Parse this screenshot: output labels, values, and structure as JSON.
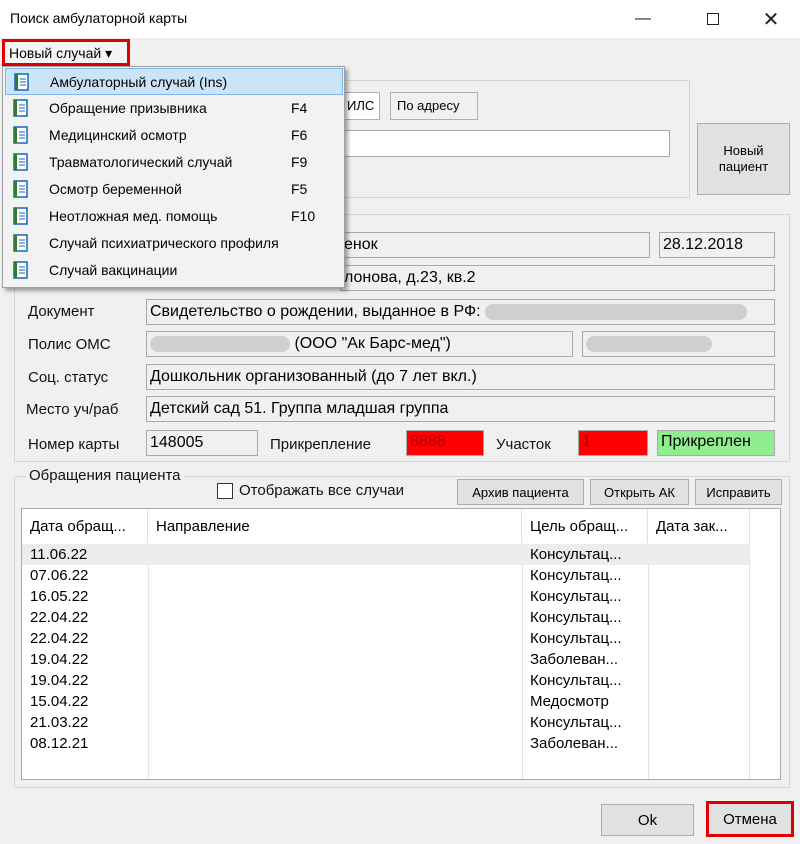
{
  "window": {
    "title": "Поиск амбулаторной карты"
  },
  "menu": {
    "new_case": "Новый случай ▾"
  },
  "dropdown": {
    "items": [
      {
        "label": "Амбулаторный случай (Ins)",
        "key": "",
        "selected": true
      },
      {
        "label": "Обращение призывника",
        "key": "F4"
      },
      {
        "label": "Медицинский осмотр",
        "key": "F6"
      },
      {
        "label": "Травматологический случай",
        "key": "F9"
      },
      {
        "label": "Осмотр беременной",
        "key": "F5"
      },
      {
        "label": "Неотложная мед. помощь",
        "key": "F10"
      },
      {
        "label": "Случай психиатрического профиля",
        "key": ""
      },
      {
        "label": "Случай вакцинации",
        "key": ""
      }
    ],
    "icon": "document-icon"
  },
  "search": {
    "tabs": [
      "ИЛС",
      "По адресу"
    ],
    "new_patient_button": "Новый пациент"
  },
  "patient": {
    "name_partial": "енок",
    "birth_date": "28.12.2018",
    "address_partial": "лонова, д.23, кв.2",
    "document_label": "Документ",
    "document_value": "Свидетельство о рождении, выданное в РФ:",
    "oms_label": "Полис ОМС",
    "oms_value": "(ООО \"Ак Барс-мед\")",
    "social_label": "Соц. статус",
    "social_value": "Дошкольник организованный (до 7 лет вкл.)",
    "work_label": "Место уч/раб",
    "work_value": "Детский сад 51. Группа младшая группа",
    "card_label": "Номер карты",
    "card_value": "148005",
    "attach_label": "Прикрепление",
    "attach_value": "8888",
    "district_label": "Участок",
    "district_value": "1",
    "attached_status": "Прикреплен"
  },
  "visits": {
    "group_title": "Обращения пациента",
    "show_all_label": "Отображать все случаи",
    "archive_button": "Архив пациента",
    "open_button": "Открыть АК",
    "fix_button": "Исправить",
    "columns": [
      "Дата обращ...",
      "Направление",
      "Цель обращ...",
      "Дата зак..."
    ],
    "rows": [
      {
        "date": "11.06.22",
        "direction": "",
        "purpose": "Консультац...",
        "closed": ""
      },
      {
        "date": "07.06.22",
        "direction": "",
        "purpose": "Консультац...",
        "closed": ""
      },
      {
        "date": "16.05.22",
        "direction": "",
        "purpose": "Консультац...",
        "closed": ""
      },
      {
        "date": "22.04.22",
        "direction": "",
        "purpose": "Консультац...",
        "closed": ""
      },
      {
        "date": "22.04.22",
        "direction": "",
        "purpose": "Консультац...",
        "closed": ""
      },
      {
        "date": "19.04.22",
        "direction": "",
        "purpose": "Заболеван...",
        "closed": ""
      },
      {
        "date": "19.04.22",
        "direction": "",
        "purpose": "Консультац...",
        "closed": ""
      },
      {
        "date": "15.04.22",
        "direction": "",
        "purpose": "Медосмотр",
        "closed": ""
      },
      {
        "date": "21.03.22",
        "direction": "",
        "purpose": "Консультац...",
        "closed": ""
      },
      {
        "date": "08.12.21",
        "direction": "",
        "purpose": "Заболеван...",
        "closed": ""
      }
    ]
  },
  "footer": {
    "ok": "Ok",
    "cancel": "Отмена"
  }
}
